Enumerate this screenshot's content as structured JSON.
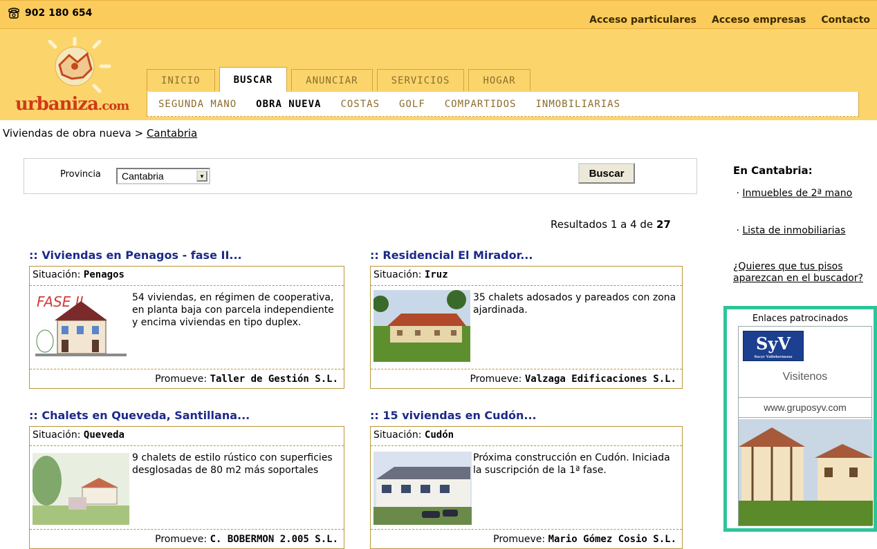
{
  "top": {
    "phone": "902 180 654",
    "links": [
      "Acceso particulares",
      "Acceso empresas",
      "Contacto"
    ]
  },
  "logo": {
    "text": "urbaniza",
    "suffix": ".com"
  },
  "tabs": [
    {
      "label": "INICIO",
      "active": false
    },
    {
      "label": "BUSCAR",
      "active": true
    },
    {
      "label": "ANUNCIAR",
      "active": false
    },
    {
      "label": "SERVICIOS",
      "active": false
    },
    {
      "label": "HOGAR",
      "active": false
    }
  ],
  "subnav": [
    {
      "label": "SEGUNDA MANO",
      "active": false
    },
    {
      "label": "OBRA NUEVA",
      "active": true
    },
    {
      "label": "COSTAS",
      "active": false
    },
    {
      "label": "GOLF",
      "active": false
    },
    {
      "label": "COMPARTIDOS",
      "active": false
    },
    {
      "label": "INMOBILIARIAS",
      "active": false
    }
  ],
  "breadcrumb": {
    "prefix": "Viviendas de obra nueva >",
    "link": "Cantabria"
  },
  "search": {
    "label": "Provincia",
    "selected": "Cantabria",
    "button": "Buscar"
  },
  "results": {
    "prefix": "Resultados 1 a 4 de",
    "total": "27"
  },
  "cards": [
    {
      "title": ":: Viviendas en Penagos - fase II...",
      "sit_label": "Situación:",
      "sit_value": "Penagos",
      "desc": "54 viviendas, en régimen de cooperativa, en planta baja con parcela independiente y encima viviendas en tipo duplex.",
      "prom_label": "Promueve:",
      "prom_value": "Taller de Gestión S.L.",
      "thumb_label": "FASE II"
    },
    {
      "title": ":: Residencial El Mirador...",
      "sit_label": "Situación:",
      "sit_value": "Iruz",
      "desc": "35 chalets adosados y pareados con zona ajardinada.",
      "prom_label": "Promueve:",
      "prom_value": "Valzaga Edificaciones S.L."
    },
    {
      "title": ":: Chalets en Queveda, Santillana...",
      "sit_label": "Situación:",
      "sit_value": "Queveda",
      "desc": "9 chalets de estilo rústico con superficies desglosadas de 80 m2 más soportales",
      "prom_label": "Promueve:",
      "prom_value": "C. BOBERMON 2.005 S.L."
    },
    {
      "title": ":: 15 viviendas en Cudón...",
      "sit_label": "Situación:",
      "sit_value": "Cudón",
      "desc": "Próxima construcción en Cudón. Iniciada la suscripción de la 1ª fase.",
      "prom_label": "Promueve:",
      "prom_value": "Mario Gómez Cosio S.L."
    }
  ],
  "sidebar": {
    "title": "En Cantabria:",
    "link1": "Inmuebles de 2ª mano",
    "link2": "Lista de inmobiliarias",
    "link3": "¿Quieres que tus pisos aparezcan en el buscador?"
  },
  "ad": {
    "title": "Enlaces patrocinados",
    "logo": "SyV",
    "logo_tag": "Sacyr Vallehermoso",
    "visit": "Visitenos",
    "url": "www.gruposyv.com"
  },
  "colors": {
    "accent": "#fbcb5c",
    "link": "#1b2a8a",
    "ad_border": "#2ec49a"
  }
}
